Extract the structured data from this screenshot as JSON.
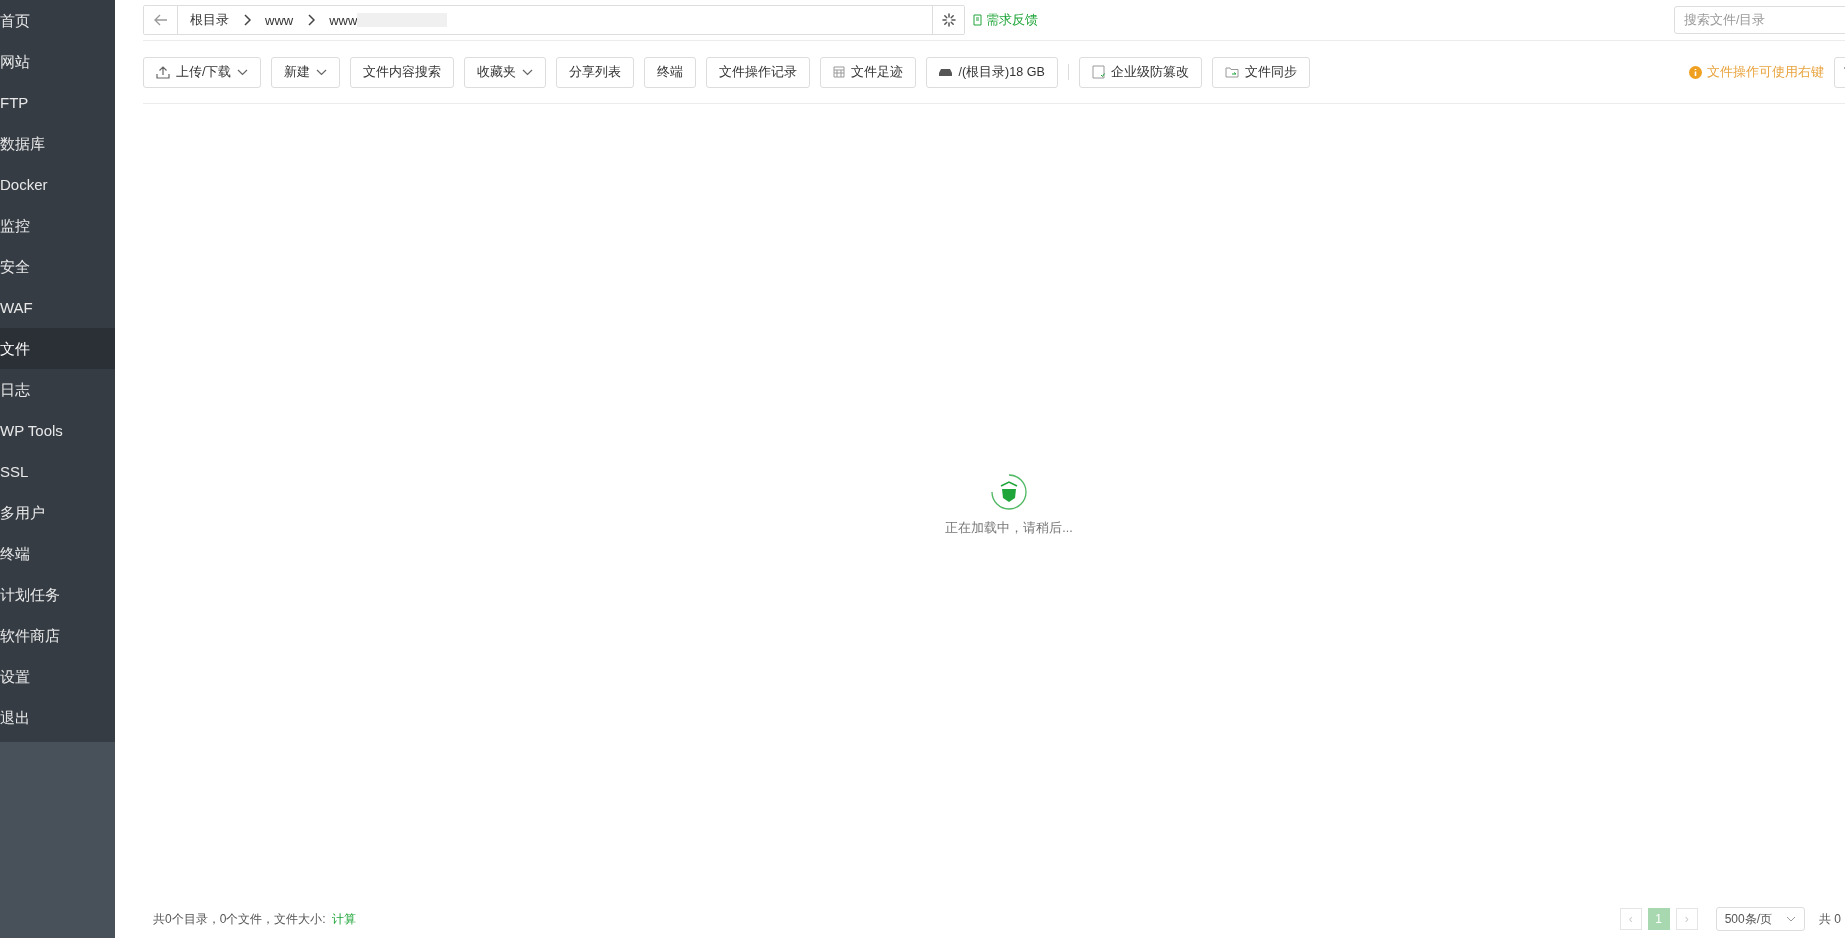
{
  "sidebar": {
    "items": [
      {
        "label": "首页",
        "selected": false
      },
      {
        "label": "网站",
        "selected": false
      },
      {
        "label": "FTP",
        "selected": false
      },
      {
        "label": "数据库",
        "selected": false
      },
      {
        "label": "Docker",
        "selected": false
      },
      {
        "label": "监控",
        "selected": false
      },
      {
        "label": "安全",
        "selected": false
      },
      {
        "label": "WAF",
        "selected": false
      },
      {
        "label": "文件",
        "selected": true
      },
      {
        "label": "日志",
        "selected": false
      },
      {
        "label": "WP Tools",
        "selected": false
      },
      {
        "label": "SSL",
        "selected": false
      },
      {
        "label": "多用户",
        "selected": false
      },
      {
        "label": "终端",
        "selected": false
      },
      {
        "label": "计划任务",
        "selected": false
      },
      {
        "label": "软件商店",
        "selected": false
      },
      {
        "label": "设置",
        "selected": false
      },
      {
        "label": "退出",
        "selected": false
      }
    ]
  },
  "breadcrumb": [
    "根目录",
    "www",
    "www"
  ],
  "feedback_link": "需求反馈",
  "search": {
    "placeholder": "搜索文件/目录"
  },
  "toolbar_groups": [
    [
      {
        "label": "上传/下载",
        "kind": "upload"
      },
      {
        "label": "新建",
        "kind": "menu"
      },
      {
        "label": "文件内容搜索",
        "kind": "plain"
      },
      {
        "label": "收藏夹",
        "kind": "menu"
      },
      {
        "label": "分享列表",
        "kind": "plain"
      },
      {
        "label": "终端",
        "kind": "plain"
      },
      {
        "label": "文件操作记录",
        "kind": "plain"
      },
      {
        "label": "文件足迹",
        "kind": "calendar"
      },
      {
        "label": "/(根目录)18 GB",
        "kind": "disk"
      }
    ],
    [
      {
        "label": "企业级防篡改",
        "kind": "document"
      },
      {
        "label": "文件同步",
        "kind": "sync"
      }
    ]
  ],
  "tip": "文件操作可使用右键",
  "loading": {
    "text": "正在加载中，请稍后..."
  },
  "footer": {
    "summary": "共0个目录，0个文件，文件大小:",
    "calc_link": "计算"
  },
  "pagination": {
    "prev": "‹",
    "next": "›",
    "pages": [
      {
        "label": "1",
        "selected": true
      }
    ],
    "page_size": "500条/页",
    "total": "共 0"
  }
}
